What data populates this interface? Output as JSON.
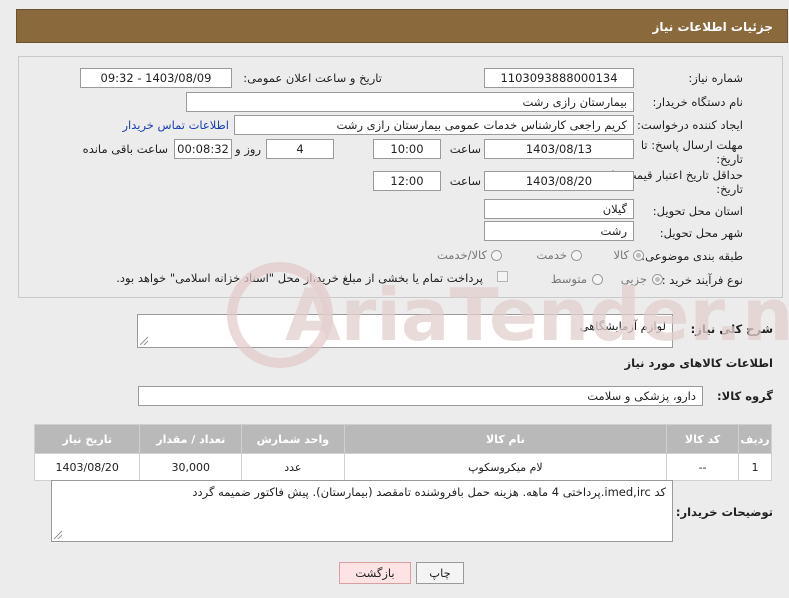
{
  "header": {
    "title": "جزئیات اطلاعات نیاز"
  },
  "form": {
    "need_number_label": "شماره نیاز:",
    "need_number": "1103093888000134",
    "announce_label": "تاریخ و ساعت اعلان عمومی:",
    "announce_value": "1403/08/09 - 09:32",
    "buyer_org_label": "نام دستگاه خریدار:",
    "buyer_org": "بیمارستان رازی رشت",
    "creator_label": "ایجاد کننده درخواست:",
    "creator": "کریم راجعی کارشناس خدمات عمومی بیمارستان رازی رشت",
    "contact_link": "اطلاعات تماس خریدار",
    "reply_deadline_label_1": "مهلت ارسال پاسخ: تا",
    "reply_deadline_label_2": "تاریخ:",
    "reply_date": "1403/08/13",
    "time_label": "ساعت",
    "reply_time": "10:00",
    "days": "4",
    "days_label": "روز و",
    "remaining_time": "00:08:32",
    "remaining_label": "ساعت باقی مانده",
    "price_validity_label_1": "حداقل تاریخ اعتبار قیمت: تا",
    "price_validity_label_2": "تاریخ:",
    "validity_date": "1403/08/20",
    "validity_time": "12:00",
    "province_label": "استان محل تحویل:",
    "province": "گیلان",
    "city_label": "شهر محل تحویل:",
    "city": "رشت",
    "category_label": "طبقه بندی موضوعی:",
    "category_options": [
      "کالا",
      "خدمت",
      "کالا/خدمت"
    ],
    "process_label": "نوع فرآیند خرید :",
    "process_options": [
      "جزیی",
      "متوسط"
    ],
    "treasury_note": "پرداخت تمام یا بخشی از مبلغ خرید،از محل \"اسناد خزانه اسلامی\" خواهد بود."
  },
  "summary": {
    "label": "شرح کلی نیاز:",
    "value": "لوازم آزمایشگاهی"
  },
  "goods_section": {
    "title": "اطلاعات کالاهای مورد نیاز",
    "group_label": "گروه کالا:",
    "group_value": "دارو، پزشکی و سلامت"
  },
  "table": {
    "headers": [
      "ردیف",
      "کد کالا",
      "نام کالا",
      "واحد شمارش",
      "تعداد / مقدار",
      "تاریخ نیاز"
    ],
    "rows": [
      [
        "1",
        "--",
        "لام میکروسکوپ",
        "عدد",
        "30,000",
        "1403/08/20"
      ]
    ]
  },
  "buyer_notes": {
    "label": "توضیحات خریدار:",
    "value": "کد imed,irc.پرداختی 4 ماهه. هزینه حمل بافروشنده تامقصد (بیمارستان). پیش فاکتور ضمیمه گردد"
  },
  "buttons": {
    "print": "چاپ",
    "back": "بازگشت"
  },
  "watermark": {
    "text": "AriaTender.neT"
  },
  "colors": {
    "header": "#8a6a3c",
    "link": "#1a3fb0",
    "table_header": "#b9b9b9"
  }
}
